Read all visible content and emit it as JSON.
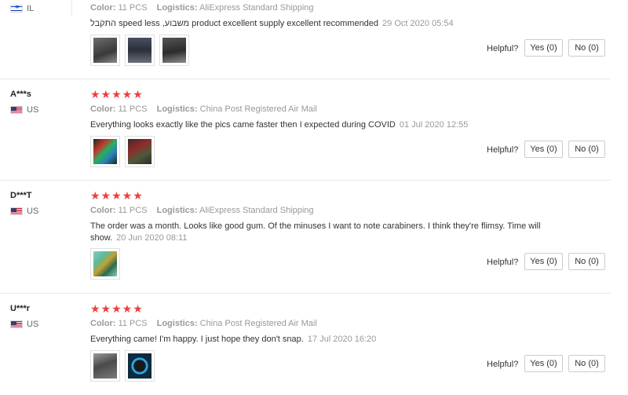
{
  "reviews": [
    {
      "user": "",
      "country": "IL",
      "flag": "il",
      "stars": "",
      "color_label": "Color:",
      "color_value": "11 PCS",
      "logistics_label": "Logistics:",
      "logistics_value": "AliExpress Standard Shipping",
      "text": "התקבל speed less ,משבוע product excellent supply excellent recommended",
      "date": "29 Oct 2020 05:54",
      "helpful_label": "Helpful?",
      "yes_label": "Yes (0)",
      "no_label": "No (0)",
      "photos": [
        "#4a4a4a",
        "#5a5f6a",
        "#3c3c3c"
      ]
    },
    {
      "user": "A***s",
      "country": "US",
      "flag": "us",
      "stars": "★★★★★",
      "color_label": "Color:",
      "color_value": "11 PCS",
      "logistics_label": "Logistics:",
      "logistics_value": "China Post Registered Air Mail",
      "text": "Everything looks exactly like the pics came faster then I expected during COVID",
      "date": "01 Jul 2020 12:55",
      "helpful_label": "Helpful?",
      "yes_label": "Yes (0)",
      "no_label": "No (0)",
      "photos": [
        "#2e3b2a",
        "#5b3a3a"
      ]
    },
    {
      "user": "D***T",
      "country": "US",
      "flag": "us",
      "stars": "★★★★★",
      "color_label": "Color:",
      "color_value": "11 PCS",
      "logistics_label": "Logistics:",
      "logistics_value": "AliExpress Standard Shipping",
      "text": "The order was a month. Looks like good gum. Of the minuses I want to note carabiners. I think they're flimsy. Time will show.",
      "date": "20 Jun 2020 08:11",
      "helpful_label": "Helpful?",
      "yes_label": "Yes (0)",
      "no_label": "No (0)",
      "photos": [
        "#6fb8a8"
      ]
    },
    {
      "user": "U***r",
      "country": "US",
      "flag": "us",
      "stars": "★★★★★",
      "color_label": "Color:",
      "color_value": "11 PCS",
      "logistics_label": "Logistics:",
      "logistics_value": "China Post Registered Air Mail",
      "text": "Everything came! I'm happy. I just hope they don't snap.",
      "date": "17 Jul 2020 16:20",
      "helpful_label": "Helpful?",
      "yes_label": "Yes (0)",
      "no_label": "No (0)",
      "photos": [
        "#555555",
        "#2a4d6e"
      ]
    }
  ]
}
